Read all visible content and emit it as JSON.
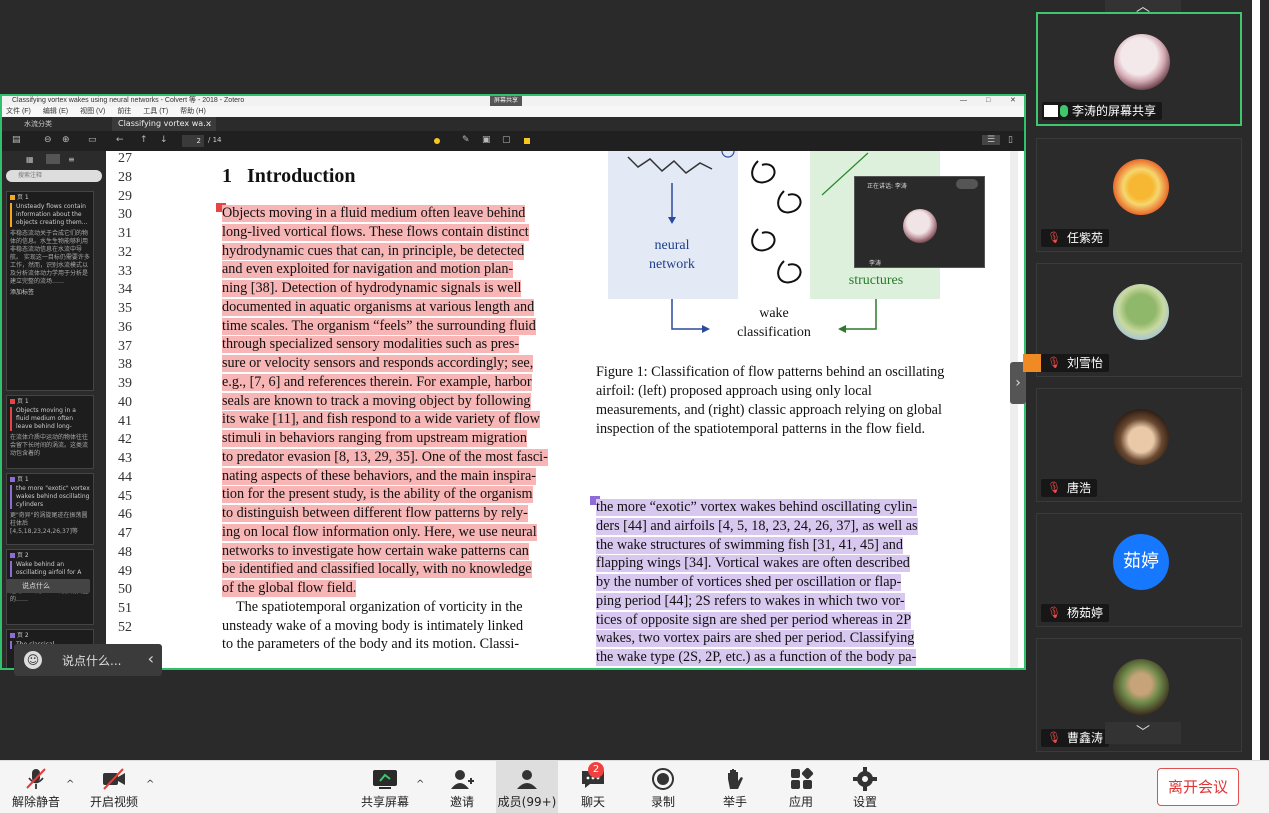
{
  "zotero": {
    "title": "Classifying vortex wakes using neural networks - Colvert 等 - 2018 - Zotero",
    "share_tag": "屏幕共享",
    "window_controls": [
      "—",
      "□",
      "✕"
    ],
    "menu": [
      "文件 (F)",
      "编辑 (E)",
      "视图 (V)",
      "前往",
      "工具 (T)",
      "帮助 (H)"
    ],
    "collection_tab": "水流分类",
    "doc_tab": "Classifying vortex wa...",
    "doc_tab_close": "×",
    "page_current": "2",
    "page_total": "/ 14",
    "search_placeholder": "搜索注释",
    "annotation_colors": {
      "red": "#e64545",
      "purple": "#8e6bd6",
      "yellow": "#f6a623",
      "highlight_red": "#f7b5b5",
      "highlight_purple": "#d8c8f0"
    },
    "annotations": [
      {
        "page": "页 1",
        "quote": "Unsteady flows contain information about the objects creating them...",
        "comment": "非稳态流动关于合成它们的物体的信息。水生生物能够利用非稳态流动信息在水流中导航。 实现这一目标仍需要许多工作，然而，识别水流模式以及分析流体动力学用于分析是建立完整的流场……",
        "tag": "添加标签"
      },
      {
        "page": "页 1",
        "quote": "Objects moving in a fluid medium often leave behind long-",
        "comment": "在流体介质中运动的物体往往会留下长时间的涡流。这类流动包含着的"
      },
      {
        "page": "页 1",
        "quote": "the more \"exotic\" vortex wakes behind oscillating cylinders",
        "comment": "更\"奇异\"的涡旋尾迹在振荡圆柱体后 [4,5,18,23,24,26,37]等"
      },
      {
        "page": "页 2",
        "quote": "Wake behind an oscillating airfoil for A",
        "comment": "如 (A) 所示，A=1.65时的尾迹约0.01到0.079的振荡翼型的……"
      },
      {
        "page": "页 2",
        "quote": "The classical",
        "comment": ""
      }
    ],
    "line_numbers": [
      "27",
      "28",
      "29",
      "30",
      "31",
      "32",
      "33",
      "34",
      "35",
      "36",
      "37",
      "38",
      "39",
      "40",
      "41",
      "42",
      "43",
      "44",
      "45",
      "46",
      "47",
      "48",
      "49",
      "50",
      "51",
      "52"
    ],
    "section_number": "1",
    "section_title": "Introduction",
    "left_column": [
      "Objects moving in a fluid medium often leave behind",
      "long-lived vortical flows.  These flows contain distinct",
      "hydrodynamic cues that can, in principle, be detected",
      "and even exploited for navigation and motion plan-",
      "ning [38].  Detection of hydrodynamic signals is well",
      "documented in aquatic organisms at various length and",
      "time scales. The organism “feels” the surrounding fluid",
      "through specialized sensory modalities such as pres-",
      "sure or velocity sensors and responds accordingly; see,",
      "e.g., [7, 6] and references therein. For example, harbor",
      "seals are known to track a moving object by following",
      "its wake [11], and fish respond to a wide variety of flow",
      "stimuli in behaviors ranging from upstream migration",
      "to predator evasion [8, 13, 29, 35]. One of the most fasci-",
      "nating aspects of these behaviors, and the main inspira-",
      "tion for the present study, is the ability of the organism",
      "to distinguish between different flow patterns by rely-",
      "ing on local flow information only. Here, we use neural",
      "networks to investigate how certain wake patterns can",
      "be identified and classified locally, with no knowledge",
      "of the global flow field.",
      "The spatiotemporal organization of vorticity in the",
      "unsteady wake of a moving body is intimately linked",
      "to the parameters of the body and its motion.  Classi-"
    ],
    "figure": {
      "label_left_1": "neural",
      "label_left_2": "network",
      "label_right": "structures",
      "label_bottom_1": "wake",
      "label_bottom_2": "classification"
    },
    "figure_caption": "Figure 1: Classification of flow patterns behind an oscillating airfoil:  (left) proposed approach using only local measurements, and (right) classic approach relying on global inspection of the spatiotemporal patterns in the flow field.",
    "right_column": [
      "the more “exotic” vortex wakes behind oscillating cylin-",
      "ders [44] and airfoils [4, 5, 18, 23, 24, 26, 37], as well as",
      "the wake structures of swimming fish [31, 41, 45] and",
      "flapping wings [34].  Vortical wakes are often described",
      "by the number of vortices shed per oscillation or flap-",
      "ping period [44]; 2S refers to wakes in which two vor-",
      "tices of opposite sign are shed per period whereas in 2P",
      "wakes, two vortex pairs are shed per period. Classifying",
      "the wake type (2S, 2P, etc.) as a function of the body pa-"
    ]
  },
  "mini_window": {
    "speaking_label": "正在讲话: 李涛",
    "name": "李涛"
  },
  "chat": {
    "placeholder": "说点什么...",
    "collapse": "‹",
    "mini_placeholder": "说点什么"
  },
  "side_handle": "›",
  "gallery": {
    "up": "︿",
    "down": "﹀",
    "participants": [
      {
        "name": "李涛的屏幕共享",
        "active": true,
        "screen_share": true
      },
      {
        "name": "任紫苑"
      },
      {
        "name": "刘雪怡",
        "flag": true
      },
      {
        "name": "唐浩"
      },
      {
        "name": "杨茹婷",
        "initials": "茹婷"
      },
      {
        "name": "曹鑫涛"
      }
    ]
  },
  "toolbar": {
    "unmute": "解除静音",
    "start_video": "开启视频",
    "share_screen": "共享屏幕",
    "invite": "邀请",
    "members": "成员(99+)",
    "chat": "聊天",
    "chat_badge": "2",
    "record": "录制",
    "raise_hand": "举手",
    "apps": "应用",
    "settings": "设置",
    "leave": "离开会议",
    "caret": "^"
  },
  "colors": {
    "active_green": "#2fc26b",
    "leave_red": "#e03535",
    "avatar_blue": "#1677ff"
  }
}
